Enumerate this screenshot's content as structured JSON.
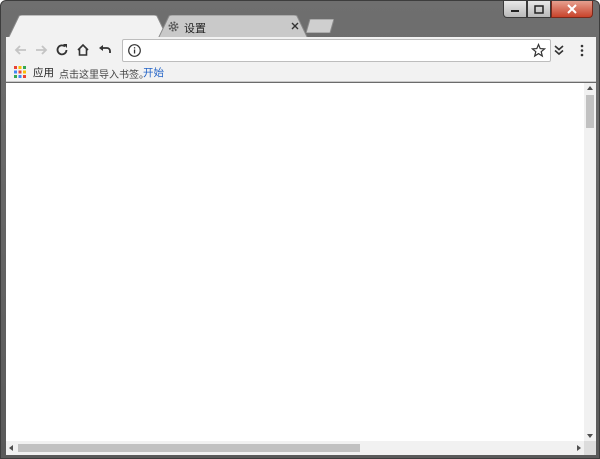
{
  "window": {
    "caption_buttons": [
      {
        "name": "minimize-icon"
      },
      {
        "name": "maximize-icon"
      },
      {
        "name": "close-icon"
      }
    ]
  },
  "tabs": [
    {
      "label": "",
      "active": true
    },
    {
      "label": "设置",
      "icon": "gear-icon",
      "active": false,
      "close_icon": "close-icon"
    }
  ],
  "toolbar": {
    "buttons": [
      "back-arrow-icon",
      "forward-arrow-icon",
      "reload-icon",
      "home-icon",
      "undo-icon"
    ],
    "omnibox": {
      "value": "",
      "placeholder": "",
      "left_icon": "info-icon",
      "right_icon": "star-icon"
    },
    "extensions": [
      "double-chevron-icon",
      "more-vert-icon"
    ]
  },
  "bookmarks_bar": {
    "apps_label": "应用",
    "prompt_text": "点击这里导入书签。",
    "prompt_link": "开始"
  },
  "colors": {
    "frame": "#5f5f5f",
    "active_tab": "#f2f2f2",
    "inactive_tab": "#c9c9c9",
    "link": "#2565c7",
    "close_button": "#c8432b"
  }
}
